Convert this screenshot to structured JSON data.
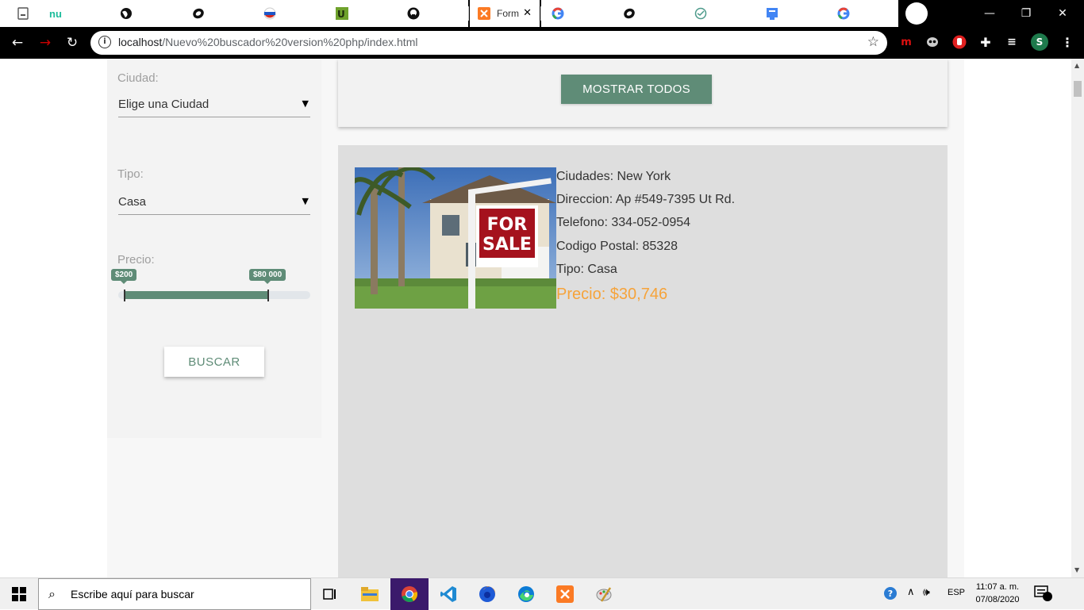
{
  "browser": {
    "active_tab_title": "Form",
    "url_host": "localhost",
    "url_path": "/Nuevo%20buscador%20version%20php/index.html",
    "profile_initial": "S",
    "tab_favicons": [
      "page-icon",
      "nu-icon",
      "globe-icon",
      "onshape-icon",
      "russia-flag-icon",
      "upwork-icon",
      "github-icon",
      "xampp-icon",
      "google-icon",
      "onshape-icon",
      "monitor-icon",
      "gdocs-icon",
      "google-icon"
    ],
    "ext_m": "m"
  },
  "filters": {
    "ciudad_label": "Ciudad:",
    "ciudad_value": "Elige una Ciudad",
    "tipo_label": "Tipo:",
    "tipo_value": "Casa",
    "precio_label": "Precio:",
    "precio_min": "$200",
    "precio_max": "$80 000",
    "buscar_label": "BUSCAR"
  },
  "actions": {
    "mostrar_todos": "MOSTRAR TODOS"
  },
  "listing": {
    "ciudad": "Ciudades: New York",
    "direccion": "Direccion: Ap #549-7395 Ut Rd.",
    "telefono": "Telefono: 334-052-0954",
    "codigo_postal": "Codigo Postal: 85328",
    "tipo": "Tipo: Casa",
    "precio": "Precio: $30,746",
    "sign_line1": "FOR",
    "sign_line2": "SALE"
  },
  "taskbar": {
    "search_placeholder": "Escribe aquí para buscar",
    "lang": "ESP",
    "time": "11:07 a. m.",
    "date": "07/08/2020"
  },
  "colors": {
    "accent": "#5f8c77",
    "price": "#f6a33a"
  }
}
